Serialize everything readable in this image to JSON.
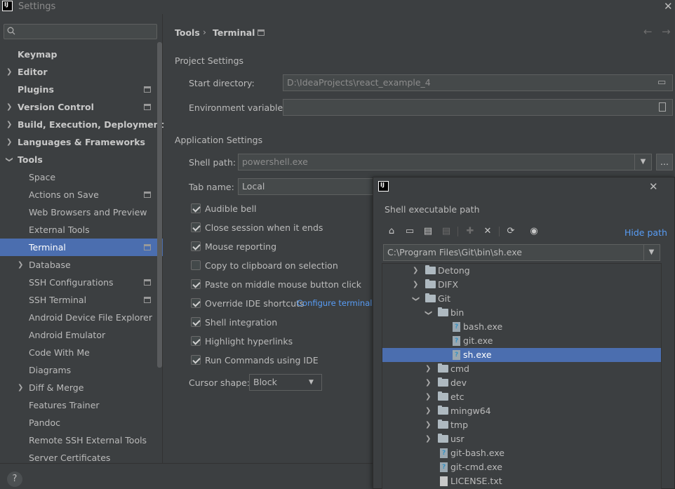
{
  "window": {
    "title": "Settings",
    "logo": "IJ"
  },
  "search": {
    "placeholder": ""
  },
  "sidebar": {
    "items": [
      {
        "label": "Keymap"
      },
      {
        "label": "Editor"
      },
      {
        "label": "Plugins"
      },
      {
        "label": "Version Control"
      },
      {
        "label": "Build, Execution, Deployment"
      },
      {
        "label": "Languages & Frameworks"
      },
      {
        "label": "Tools"
      },
      {
        "label": "Space"
      },
      {
        "label": "Actions on Save"
      },
      {
        "label": "Web Browsers and Preview"
      },
      {
        "label": "External Tools"
      },
      {
        "label": "Terminal"
      },
      {
        "label": "Database"
      },
      {
        "label": "SSH Configurations"
      },
      {
        "label": "SSH Terminal"
      },
      {
        "label": "Android Device File Explorer"
      },
      {
        "label": "Android Emulator"
      },
      {
        "label": "Code With Me"
      },
      {
        "label": "Diagrams"
      },
      {
        "label": "Diff & Merge"
      },
      {
        "label": "Features Trainer"
      },
      {
        "label": "Pandoc"
      },
      {
        "label": "Remote SSH External Tools"
      },
      {
        "label": "Server Certificates"
      }
    ]
  },
  "breadcrumb": {
    "parent": "Tools",
    "separator": "›",
    "current": "Terminal"
  },
  "project_settings": {
    "title": "Project Settings",
    "start_dir_label": "Start directory:",
    "start_dir_value": "D:\\IdeaProjects\\react_example_4",
    "env_label": "Environment variables:",
    "env_value": ""
  },
  "app_settings": {
    "title": "Application Settings",
    "shell_label": "Shell path:",
    "shell_value": "powershell.exe",
    "browse_label": "...",
    "tab_label": "Tab name:",
    "tab_value": "Local",
    "checkboxes": [
      {
        "label": "Audible bell",
        "checked": true
      },
      {
        "label": "Close session when it ends",
        "checked": true
      },
      {
        "label": "Mouse reporting",
        "checked": true
      },
      {
        "label": "Copy to clipboard on selection",
        "checked": false
      },
      {
        "label": "Paste on middle mouse button click",
        "checked": true
      },
      {
        "label": "Override IDE shortcuts",
        "checked": true
      },
      {
        "label": "Shell integration",
        "checked": true
      },
      {
        "label": "Highlight hyperlinks",
        "checked": true
      },
      {
        "label": "Run Commands using IDE",
        "checked": true
      }
    ],
    "configure_link": "Configure terminal k",
    "cursor_label": "Cursor shape:",
    "cursor_value": "Block"
  },
  "dialog": {
    "logo": "IJ",
    "title": "Shell executable path",
    "hide_path": "Hide path",
    "path_value": "C:\\Program Files\\Git\\bin\\sh.exe",
    "tree": [
      {
        "label": "Detong"
      },
      {
        "label": "DIFX"
      },
      {
        "label": "Git"
      },
      {
        "label": "bin"
      },
      {
        "label": "bash.exe"
      },
      {
        "label": "git.exe"
      },
      {
        "label": "sh.exe"
      },
      {
        "label": "cmd"
      },
      {
        "label": "dev"
      },
      {
        "label": "etc"
      },
      {
        "label": "mingw64"
      },
      {
        "label": "tmp"
      },
      {
        "label": "usr"
      },
      {
        "label": "git-bash.exe"
      },
      {
        "label": "git-cmd.exe"
      },
      {
        "label": "LICENSE.txt"
      }
    ]
  },
  "help": {
    "label": "?"
  },
  "colors": {
    "selection": "#4b6eaf",
    "link": "#589df6",
    "background": "#3c3f41"
  }
}
